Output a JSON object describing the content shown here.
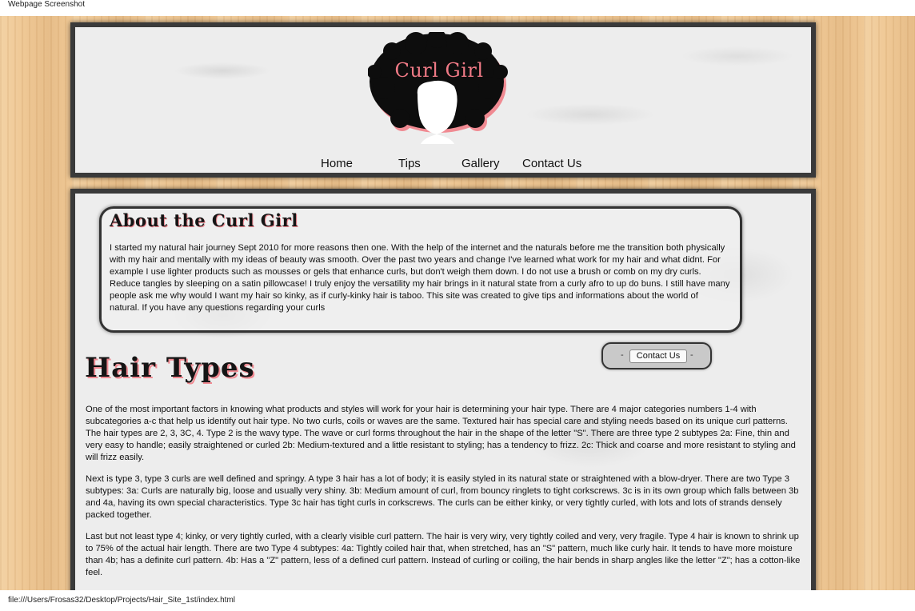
{
  "caption": "Webpage Screenshot",
  "logo": {
    "text": "Curl Girl",
    "icon": "afro-silhouette-icon",
    "accent": "#f07a86"
  },
  "nav": [
    "Home",
    "Tips",
    "Gallery",
    "Contact Us"
  ],
  "about": {
    "title": "About the Curl Girl",
    "text": "I started my natural hair journey Sept 2010 for more reasons then one. With the help of the internet and the naturals before me the transition both physically with my hair and mentally with my ideas of beauty was smooth. Over the past two years and change I've learned what work for my hair and what didnt. For example I use lighter products such as mousses or gels that enhance curls, but don't weigh them down. I do not use a brush or comb on my dry curls. Reduce tangles by sleeping on a satin pillowcase! I truly enjoy the versatility my hair brings in it natural state from a curly afro to up do buns. I still have many people ask me why would I want my hair so kinky, as if curly-kinky hair is taboo. This site was created to give tips and informations about the world of natural. If you have any questions regarding your curls"
  },
  "contact_widget": {
    "button": "Contact Us",
    "dash": "-"
  },
  "hair_types": {
    "title": "Hair Types",
    "paragraphs": [
      "One of the most important factors in knowing what products and styles will work for your hair is determining your hair type. There are 4 major categories numbers 1-4 with subcategories a-c that help us identify out hair type. No two curls, coils or waves are the same. Textured hair has special care and styling needs based on its unique curl patterns. The hair types are 2, 3, 3C, 4. Type 2 is the wavy type. The wave or curl forms throughout the hair in the shape of the letter \"S\". There are three type 2 subtypes 2a: Fine, thin and very easy to handle; easily straightened or curled 2b: Medium-textured and a little resistant to styling; has a tendency to frizz. 2c: Thick and coarse and more resistant to styling and will frizz easily.",
      "Next is type 3, type 3 curls are well defined and springy. A type 3 hair has a lot of body; it is easily styled in its natural state or straightened with a blow-dryer. There are two Type 3 subtypes: 3a: Curls are naturally big, loose and usually very shiny. 3b: Medium amount of curl, from bouncy ringlets to tight corkscrews. 3c is in its own group which falls between 3b and 4a, having its own special characteristics. Type 3c hair has tight curls in corkscrews. The curls can be either kinky, or very tightly curled, with lots and lots of strands densely packed together.",
      "Last but not least type 4; kinky, or very tightly curled, with a clearly visible curl pattern. The hair is very wiry, very tightly coiled and very, very fragile. Type 4 hair is known to shrink up to 75% of the actual hair length. There are two Type 4 subtypes: 4a: Tightly coiled hair that, when stretched, has an \"S\" pattern, much like curly hair. It tends to have more moisture than 4b; has a definite curl pattern. 4b: Has a \"Z\" pattern, less of a defined curl pattern. Instead of curling or coiling, the hair bends in sharp angles like the letter \"Z\"; has a cotton-like feel."
    ]
  },
  "status_url": "file:///Users/Frosas32/Desktop/Projects/Hair_Site_1st/index.html"
}
